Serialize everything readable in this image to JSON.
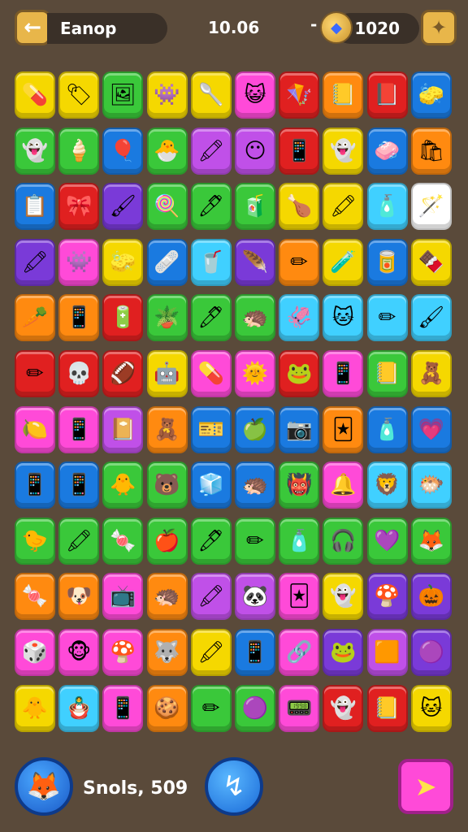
{
  "header": {
    "back_icon": "arrow-left-icon",
    "title": "Eanop",
    "timer": "10.06",
    "coin_dash": "-",
    "coins": "1020",
    "settings_icon": "puzzle-gear-icon"
  },
  "board": {
    "rows": [
      [
        {
          "c": "#f5d800",
          "g": "💊"
        },
        {
          "c": "#f5d800",
          "g": "🏷"
        },
        {
          "c": "#3ac83a",
          "g": "🖼"
        },
        {
          "c": "#f5d800",
          "g": "👾"
        },
        {
          "c": "#f5d800",
          "g": "🥄"
        },
        {
          "c": "#ff4ad8",
          "g": "😺"
        },
        {
          "c": "#e02020",
          "g": "🪁"
        },
        {
          "c": "#ff8a10",
          "g": "📒"
        },
        {
          "c": "#e02020",
          "g": "📕"
        },
        {
          "c": "#1a7ae0",
          "g": "🧽"
        }
      ],
      [
        {
          "c": "#3ac83a",
          "g": "👻"
        },
        {
          "c": "#3ac83a",
          "g": "🍦"
        },
        {
          "c": "#1a7ae0",
          "g": "🎈"
        },
        {
          "c": "#3ac83a",
          "g": "🐣"
        },
        {
          "c": "#c050e8",
          "g": "🖍"
        },
        {
          "c": "#c050e8",
          "g": "😶"
        },
        {
          "c": "#e02020",
          "g": "📱"
        },
        {
          "c": "#f5d800",
          "g": "👻"
        },
        {
          "c": "#1a7ae0",
          "g": "🧼"
        },
        {
          "c": "#ff8a10",
          "g": "🛍"
        }
      ],
      [
        {
          "c": "#1a7ae0",
          "g": "📋"
        },
        {
          "c": "#e02020",
          "g": "🎀"
        },
        {
          "c": "#7a3ad8",
          "g": "🖌"
        },
        {
          "c": "#3ac83a",
          "g": "🍭"
        },
        {
          "c": "#3ac83a",
          "g": "🖊"
        },
        {
          "c": "#3ac83a",
          "g": "🧃"
        },
        {
          "c": "#f5d800",
          "g": "🍗"
        },
        {
          "c": "#f5d800",
          "g": "🖍"
        },
        {
          "c": "#40d0ff",
          "g": "🧴"
        },
        {
          "c": "#ffffff",
          "g": "🪄"
        }
      ],
      [
        {
          "c": "#7a3ad8",
          "g": "🖍"
        },
        {
          "c": "#ff4ad8",
          "g": "👾"
        },
        {
          "c": "#f5d800",
          "g": "🧽"
        },
        {
          "c": "#1a7ae0",
          "g": "🩹"
        },
        {
          "c": "#40d0ff",
          "g": "🥤"
        },
        {
          "c": "#7a3ad8",
          "g": "🪶"
        },
        {
          "c": "#ff8a10",
          "g": "✏"
        },
        {
          "c": "#f5d800",
          "g": "🧪"
        },
        {
          "c": "#1a7ae0",
          "g": "🥫"
        },
        {
          "c": "#f5d800",
          "g": "🍫"
        }
      ],
      [
        {
          "c": "#ff8a10",
          "g": "🥕"
        },
        {
          "c": "#ff8a10",
          "g": "📱"
        },
        {
          "c": "#e02020",
          "g": "🔋"
        },
        {
          "c": "#3ac83a",
          "g": "🪴"
        },
        {
          "c": "#3ac83a",
          "g": "🖊"
        },
        {
          "c": "#3ac83a",
          "g": "🦔"
        },
        {
          "c": "#40d0ff",
          "g": "🦑"
        },
        {
          "c": "#40d0ff",
          "g": "🐱"
        },
        {
          "c": "#40d0ff",
          "g": "✏"
        },
        {
          "c": "#40d0ff",
          "g": "🖌"
        }
      ],
      [
        {
          "c": "#e02020",
          "g": "✏"
        },
        {
          "c": "#e02020",
          "g": "💀"
        },
        {
          "c": "#e02020",
          "g": "🏈"
        },
        {
          "c": "#f5d800",
          "g": "🤖"
        },
        {
          "c": "#ff4ad8",
          "g": "💊"
        },
        {
          "c": "#ff4ad8",
          "g": "🌞"
        },
        {
          "c": "#e02020",
          "g": "🐸"
        },
        {
          "c": "#ff4ad8",
          "g": "📱"
        },
        {
          "c": "#3ac83a",
          "g": "📒"
        },
        {
          "c": "#f5d800",
          "g": "🧸"
        }
      ],
      [
        {
          "c": "#ff4ad8",
          "g": "🍋"
        },
        {
          "c": "#ff4ad8",
          "g": "📱"
        },
        {
          "c": "#c050e8",
          "g": "📔"
        },
        {
          "c": "#ff8a10",
          "g": "🧸"
        },
        {
          "c": "#1a7ae0",
          "g": "🎫"
        },
        {
          "c": "#1a7ae0",
          "g": "🍏"
        },
        {
          "c": "#1a7ae0",
          "g": "📷"
        },
        {
          "c": "#ff8a10",
          "g": "🃏"
        },
        {
          "c": "#1a7ae0",
          "g": "🧴"
        },
        {
          "c": "#1a7ae0",
          "g": "💗"
        }
      ],
      [
        {
          "c": "#1a7ae0",
          "g": "📱"
        },
        {
          "c": "#1a7ae0",
          "g": "📱"
        },
        {
          "c": "#3ac83a",
          "g": "🐥"
        },
        {
          "c": "#3ac83a",
          "g": "🐻"
        },
        {
          "c": "#1a7ae0",
          "g": "🧊"
        },
        {
          "c": "#1a7ae0",
          "g": "🦔"
        },
        {
          "c": "#3ac83a",
          "g": "👹"
        },
        {
          "c": "#ff4ad8",
          "g": "🔔"
        },
        {
          "c": "#40d0ff",
          "g": "🦁"
        },
        {
          "c": "#40d0ff",
          "g": "🐡"
        }
      ],
      [
        {
          "c": "#3ac83a",
          "g": "🐤"
        },
        {
          "c": "#3ac83a",
          "g": "🖍"
        },
        {
          "c": "#3ac83a",
          "g": "🍬"
        },
        {
          "c": "#3ac83a",
          "g": "🍎"
        },
        {
          "c": "#3ac83a",
          "g": "🖊"
        },
        {
          "c": "#3ac83a",
          "g": "✏"
        },
        {
          "c": "#3ac83a",
          "g": "🧴"
        },
        {
          "c": "#3ac83a",
          "g": "🎧"
        },
        {
          "c": "#3ac83a",
          "g": "💜"
        },
        {
          "c": "#3ac83a",
          "g": "🦊"
        }
      ],
      [
        {
          "c": "#ff8a10",
          "g": "🍬"
        },
        {
          "c": "#ff8a10",
          "g": "🐶"
        },
        {
          "c": "#ff4ad8",
          "g": "📺"
        },
        {
          "c": "#ff8a10",
          "g": "🦔"
        },
        {
          "c": "#c050e8",
          "g": "🖍"
        },
        {
          "c": "#c050e8",
          "g": "🐼"
        },
        {
          "c": "#ff4ad8",
          "g": "🃏"
        },
        {
          "c": "#f5d800",
          "g": "👻"
        },
        {
          "c": "#7a3ad8",
          "g": "🍄"
        },
        {
          "c": "#7a3ad8",
          "g": "🎃"
        }
      ],
      [
        {
          "c": "#ff4ad8",
          "g": "🎲"
        },
        {
          "c": "#ff4ad8",
          "g": "🐵"
        },
        {
          "c": "#ff4ad8",
          "g": "🍄"
        },
        {
          "c": "#ff8a10",
          "g": "🐺"
        },
        {
          "c": "#f5d800",
          "g": "🖍"
        },
        {
          "c": "#1a7ae0",
          "g": "📱"
        },
        {
          "c": "#ff4ad8",
          "g": "🔗"
        },
        {
          "c": "#7a3ad8",
          "g": "🐸"
        },
        {
          "c": "#c050e8",
          "g": "🟧"
        },
        {
          "c": "#7a3ad8",
          "g": "🟣"
        }
      ],
      [
        {
          "c": "#f5d800",
          "g": "🐥"
        },
        {
          "c": "#40d0ff",
          "g": "🪆"
        },
        {
          "c": "#ff4ad8",
          "g": "📱"
        },
        {
          "c": "#ff8a10",
          "g": "🍪"
        },
        {
          "c": "#3ac83a",
          "g": "✏"
        },
        {
          "c": "#3ac83a",
          "g": "🟣"
        },
        {
          "c": "#ff4ad8",
          "g": "📟"
        },
        {
          "c": "#e02020",
          "g": "👻"
        },
        {
          "c": "#e02020",
          "g": "📒"
        },
        {
          "c": "#f5d800",
          "g": "🐱"
        }
      ]
    ]
  },
  "footer": {
    "fox_icon": "fox-avatar-icon",
    "score": "Snols, 509",
    "bolt_icon": "lightning-icon",
    "play_icon": "play-arrow-icon"
  }
}
